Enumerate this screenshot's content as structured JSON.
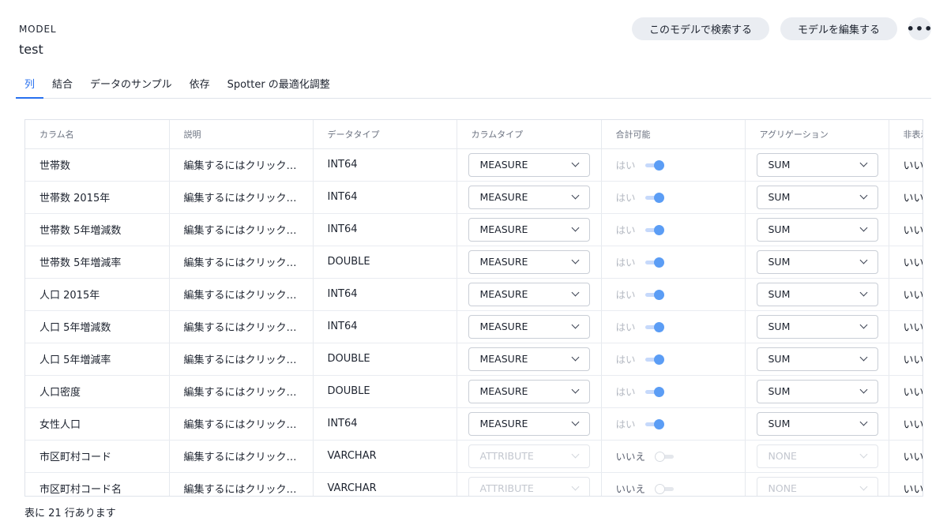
{
  "header": {
    "section": "MODEL",
    "title": "test"
  },
  "actions": {
    "search": "このモデルで検索する",
    "edit": "モデルを編集する",
    "more": "•••"
  },
  "tabs": [
    "列",
    "結合",
    "データのサンプル",
    "依存",
    "Spotter の最適化調整"
  ],
  "table": {
    "columns": [
      "カラム名",
      "説明",
      "データタイプ",
      "カラムタイプ",
      "合計可能",
      "アグリゲーション",
      "非表示"
    ],
    "rows": [
      {
        "name": "世帯数",
        "desc": "編集するにはクリック…",
        "dtype": "INT64",
        "ctype": "MEASURE",
        "additive": "はい",
        "additive_on": true,
        "agg": "SUM",
        "hidden": "いいえ"
      },
      {
        "name": "世帯数 2015年",
        "desc": "編集するにはクリック…",
        "dtype": "INT64",
        "ctype": "MEASURE",
        "additive": "はい",
        "additive_on": true,
        "agg": "SUM",
        "hidden": "いいえ"
      },
      {
        "name": "世帯数 5年増減数",
        "desc": "編集するにはクリック…",
        "dtype": "INT64",
        "ctype": "MEASURE",
        "additive": "はい",
        "additive_on": true,
        "agg": "SUM",
        "hidden": "いいえ"
      },
      {
        "name": "世帯数 5年増減率",
        "desc": "編集するにはクリック…",
        "dtype": "DOUBLE",
        "ctype": "MEASURE",
        "additive": "はい",
        "additive_on": true,
        "agg": "SUM",
        "hidden": "いいえ"
      },
      {
        "name": "人口 2015年",
        "desc": "編集するにはクリック…",
        "dtype": "INT64",
        "ctype": "MEASURE",
        "additive": "はい",
        "additive_on": true,
        "agg": "SUM",
        "hidden": "いいえ"
      },
      {
        "name": "人口 5年増減数",
        "desc": "編集するにはクリック…",
        "dtype": "INT64",
        "ctype": "MEASURE",
        "additive": "はい",
        "additive_on": true,
        "agg": "SUM",
        "hidden": "いいえ"
      },
      {
        "name": "人口 5年増減率",
        "desc": "編集するにはクリック…",
        "dtype": "DOUBLE",
        "ctype": "MEASURE",
        "additive": "はい",
        "additive_on": true,
        "agg": "SUM",
        "hidden": "いいえ"
      },
      {
        "name": "人口密度",
        "desc": "編集するにはクリック…",
        "dtype": "DOUBLE",
        "ctype": "MEASURE",
        "additive": "はい",
        "additive_on": true,
        "agg": "SUM",
        "hidden": "いいえ"
      },
      {
        "name": "女性人口",
        "desc": "編集するにはクリック…",
        "dtype": "INT64",
        "ctype": "MEASURE",
        "additive": "はい",
        "additive_on": true,
        "agg": "SUM",
        "hidden": "いいえ"
      },
      {
        "name": "市区町村コード",
        "desc": "編集するにはクリック…",
        "dtype": "VARCHAR",
        "ctype": "ATTRIBUTE",
        "additive": "いいえ",
        "additive_on": false,
        "agg": "NONE",
        "hidden": "いいえ"
      },
      {
        "name": "市区町村コード名",
        "desc": "編集するにはクリック…",
        "dtype": "VARCHAR",
        "ctype": "ATTRIBUTE",
        "additive": "いいえ",
        "additive_on": false,
        "agg": "NONE",
        "hidden": "いいえ"
      }
    ]
  },
  "footer": {
    "row_count": "表に 21 行あります"
  }
}
